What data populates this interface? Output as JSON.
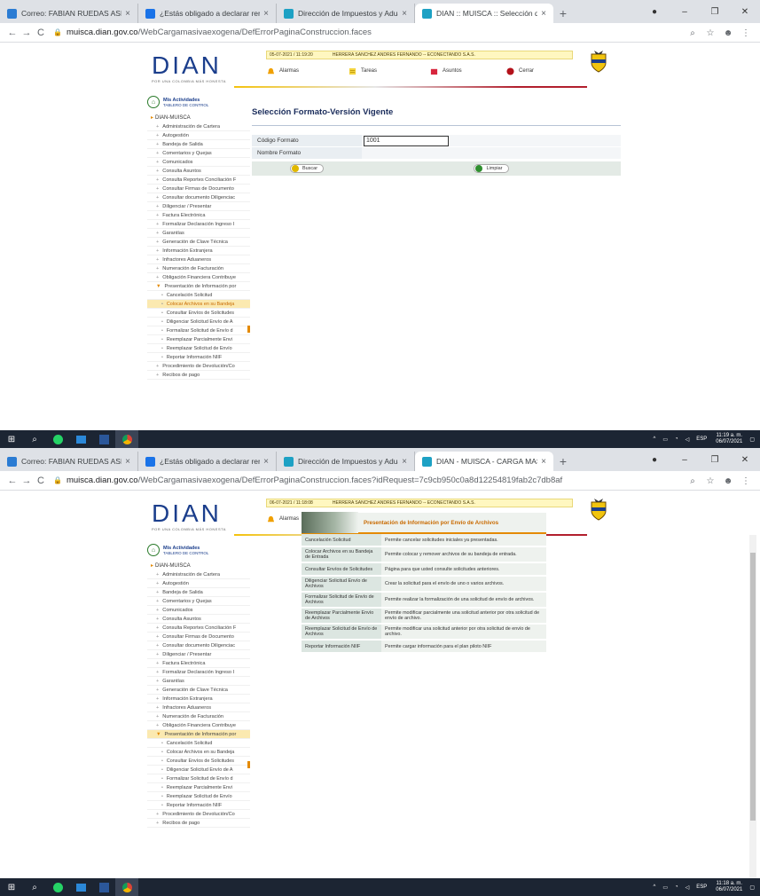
{
  "shot1": {
    "tabs": [
      {
        "title": "Correo: FABIAN RUEDAS ASESOR",
        "favicon_color": "#2b7cd3"
      },
      {
        "title": "¿Estás obligado a declarar renta",
        "favicon_color": "#1a73e8"
      },
      {
        "title": "Dirección de Impuestos y Aduana",
        "favicon_color": "#1da1c4"
      },
      {
        "title": "DIAN :: MUISCA :: Selección del",
        "favicon_color": "#1da1c4"
      }
    ],
    "url_host": "muisca.dian.gov.co",
    "url_path": "/WebCargamasivaexogena/DefErrorPaginaConstruccion.faces",
    "info_datetime": "05-07-2021 / 11:19:20",
    "info_user": "HERRERA SANCHEZ ANDRES FERNANDO -- ECONECTANDO S.A.S.",
    "clock_time": "11:19 a. m.",
    "clock_date": "06/07/2021"
  },
  "shot2": {
    "tabs": [
      {
        "title": "Correo: FABIAN RUEDAS ASESOR",
        "favicon_color": "#2b7cd3"
      },
      {
        "title": "¿Estás obligado a declarar renta",
        "favicon_color": "#1a73e8"
      },
      {
        "title": "Dirección de Impuestos y Aduana",
        "favicon_color": "#1da1c4"
      },
      {
        "title": "DIAN - MUISCA - CARGA MASIV",
        "favicon_color": "#1da1c4"
      }
    ],
    "url_host": "muisca.dian.gov.co",
    "url_path": "/WebCargamasivaexogena/DefErrorPaginaConstruccion.faces?idRequest=7c9cb950c0a8d12254819fab2c7db8af",
    "info_datetime": "06-07-2021 / 11:18:08",
    "info_user": "HERRERA SANCHEZ ANDRES FERNANDO -- ECONECTANDO S.A.S.",
    "clock_time": "11:18 a. m.",
    "clock_date": "06/07/2021"
  },
  "brand": {
    "logo": "DIAN",
    "tagline": "POR UNA COLOMBIA MÁS HONESTA",
    "accent": "#1b3e8c"
  },
  "topnav": {
    "alarmas": "Alarmas",
    "tareas": "Tareas",
    "asuntos": "Asuntos",
    "cerrar": "Cerrar"
  },
  "sidebar": {
    "mis_actividades": "Mis Actividades",
    "tablero": "TABLERO DE CONTROL",
    "root": "DIAN-MUISCA",
    "items": [
      "Administración de Cartera",
      "Autogestión",
      "Bandeja de Salida",
      "Comentarios y Quejas",
      "Comunicados",
      "Consulta Asuntos",
      "Consulta Reportes Conciliación F",
      "Consultar Firmas de Documento",
      "Consultar documento Diligenciac",
      "Diligenciar / Presentar",
      "Factura Electrónica",
      "Formalizar Declaración Ingreso I",
      "Garantías",
      "Generación de Clave Técnica",
      "Información Extranjera",
      "Infractores Aduaneros",
      "Numeración de Facturación",
      "Obligación Financiera Contribuye",
      "Presentación de Información por"
    ],
    "subitems": [
      "Cancelación Solicitud",
      "Colocar Archivos en su Bandeja",
      "Consultar Envíos de Solicitudes",
      "Diligenciar Solicitud Envío de A",
      "Formalizar Solicitud de Envío d",
      "Reemplazar Parcialmente Envi",
      "Reemplazar Solicitud de Envío",
      "Reportar Información NIIF"
    ],
    "after": [
      "Procedimiento de Devolución/Co",
      "Recibos de pago"
    ]
  },
  "form": {
    "title": "Selección Formato-Versión Vigente",
    "codigo_label": "Código Formato",
    "codigo_value": "1001",
    "nombre_label": "Nombre Formato",
    "buscar": "Buscar",
    "limpiar": "Limpiar"
  },
  "panel": {
    "title": "Presentación de Información por Envío de Archivos",
    "rows": [
      {
        "label": "Cancelación Solicitud",
        "desc": "Permite cancelar solicitudes iniciales ya presentadas."
      },
      {
        "label": "Colocar Archivos en su Bandeja de Entrada",
        "desc": "Permite colocar y remover archivos de su bandeja de entrada."
      },
      {
        "label": "Consultar Envíos de Solicitudes",
        "desc": "Página para que usted consulte solicitudes anteriores."
      },
      {
        "label": "Diligenciar Solicitud Envío de Archivos",
        "desc": "Crear la solicitud para el envío de uno o varios archivos."
      },
      {
        "label": "Formalizar Solicitud de Envío de Archivos",
        "desc": "Permite realizar la formalización de una solicitud de envío de archivos."
      },
      {
        "label": "Reemplazar Parcialmente Envío de Archivos",
        "desc": "Permite modificar parcialmente una solicitud anterior por otra solicitud de envío de archivo."
      },
      {
        "label": "Reemplazar Solicitud de Envío de Archivos",
        "desc": "Permite modificar una solicitud anterior por otra solicitud de envío de archivo."
      },
      {
        "label": "Reportar Información NIIF",
        "desc": "Permite cargar información para el plan piloto NIIF"
      }
    ]
  },
  "tray": {
    "lang": "ESP"
  },
  "colors": {
    "highlight": "#fbe9b0",
    "orange": "#e48a00",
    "taskbar": "#1c2533"
  }
}
